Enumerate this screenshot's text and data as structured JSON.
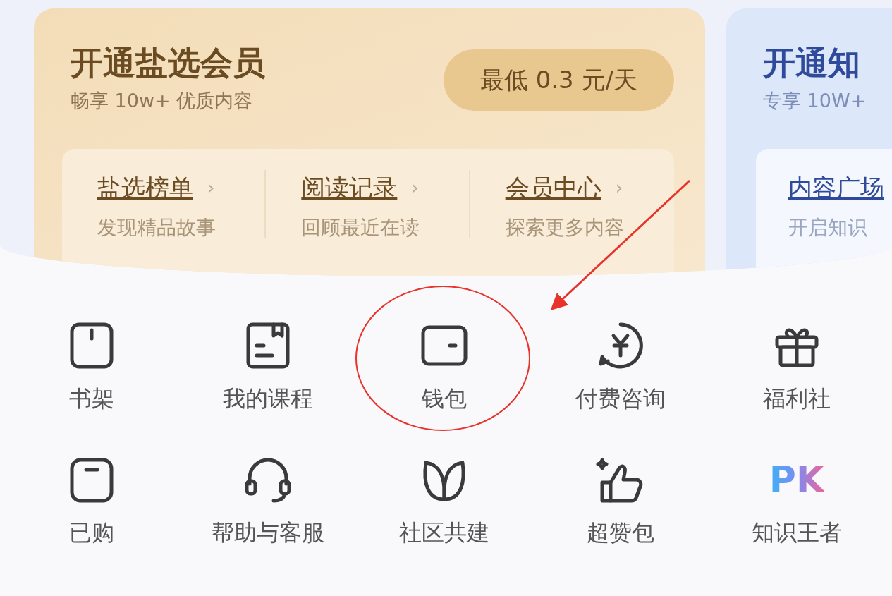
{
  "membership_cards": [
    {
      "title": "开通盐选会员",
      "subtitle": "畅享 10w+ 优质内容",
      "price_button": "最低 0.3 元/天",
      "links": [
        {
          "title": "盐选榜单",
          "chevron": "›",
          "caption": "发现精品故事"
        },
        {
          "title": "阅读记录",
          "chevron": "›",
          "caption": "回顾最近在读"
        },
        {
          "title": "会员中心",
          "chevron": "›",
          "caption": "探索更多内容"
        }
      ]
    },
    {
      "title": "开通知",
      "subtitle": "专享 10W+",
      "links": [
        {
          "title": "内容广场",
          "caption": "开启知识"
        }
      ]
    }
  ],
  "shortcuts": [
    {
      "kind": "icon",
      "label": "书架"
    },
    {
      "kind": "icon",
      "label": "我的课程"
    },
    {
      "kind": "icon",
      "label": "钱包"
    },
    {
      "kind": "icon",
      "label": "付费咨询"
    },
    {
      "kind": "icon",
      "label": "福利社"
    },
    {
      "kind": "icon",
      "label": "已购"
    },
    {
      "kind": "icon",
      "label": "帮助与客服"
    },
    {
      "kind": "icon",
      "label": "社区共建"
    },
    {
      "kind": "icon",
      "label": "超赞包"
    },
    {
      "kind": "logo",
      "logo_text": "PK",
      "label": "知识王者"
    }
  ]
}
